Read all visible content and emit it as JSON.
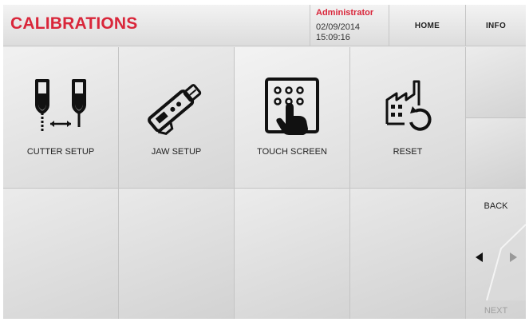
{
  "header": {
    "title": "CALIBRATIONS",
    "user": "Administrator",
    "date": "02/09/2014",
    "time": "15:09:16",
    "home_label": "HOME",
    "info_label": "INFO"
  },
  "tiles": [
    {
      "label": "CUTTER SETUP",
      "icon": "cutter-setup-icon"
    },
    {
      "label": "JAW SETUP",
      "icon": "jaw-setup-icon"
    },
    {
      "label": "TOUCH SCREEN",
      "icon": "touch-screen-icon"
    },
    {
      "label": "RESET",
      "icon": "factory-reset-icon"
    }
  ],
  "nav": {
    "back_label": "BACK",
    "next_label": "NEXT"
  },
  "colors": {
    "accent": "#d9263a",
    "text": "#222222",
    "disabled": "#a0a0a0"
  }
}
